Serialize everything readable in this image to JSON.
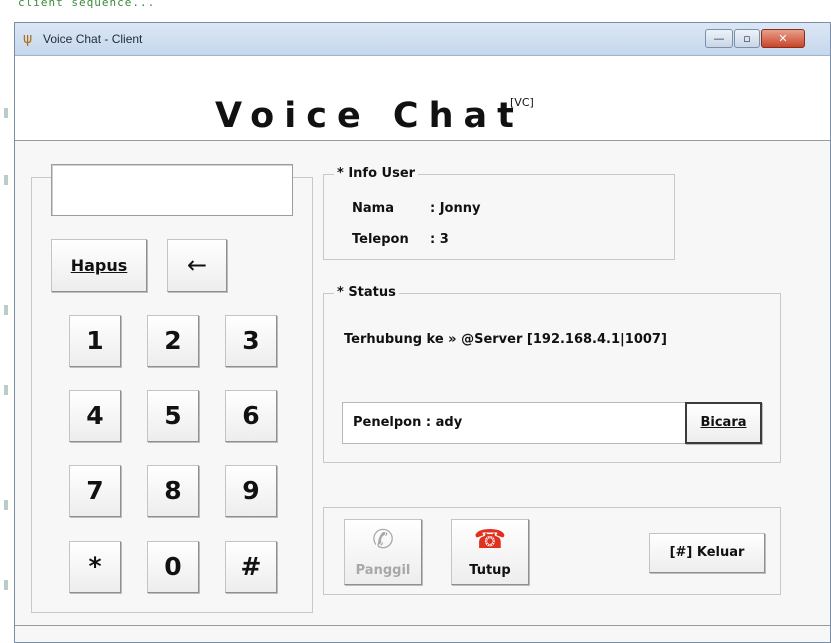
{
  "background": {
    "console_text": "client sequence..."
  },
  "window": {
    "title": "Voice Chat - Client",
    "icon": "voice-app-icon",
    "controls": {
      "minimize": "—",
      "maximize": "▫",
      "close": "✕"
    }
  },
  "header": {
    "title": "Voice Chat",
    "superscript": "[VC]"
  },
  "keypad": {
    "display_value": "",
    "hapus_label": "Hapus",
    "back_label": "←",
    "keys": [
      "1",
      "2",
      "3",
      "4",
      "5",
      "6",
      "7",
      "8",
      "9",
      "*",
      "0",
      "#"
    ]
  },
  "info_user": {
    "title": "* Info User",
    "nama_label": "Nama",
    "nama_value": ": Jonny",
    "telepon_label": "Telepon",
    "telepon_value": ": 3"
  },
  "status": {
    "title": "* Status",
    "connection": "Terhubung ke » @Server [192.168.4.1|1007]",
    "caller_text": "Penelpon : ady",
    "bicara_label": "Bicara"
  },
  "actions": {
    "panggil_label": "Panggil",
    "tutup_label": "Tutup",
    "keluar_label": "[#]  Keluar"
  },
  "colors": {
    "tutup_icon": "#e0301e",
    "panggil_icon": "#a8a8a8"
  }
}
